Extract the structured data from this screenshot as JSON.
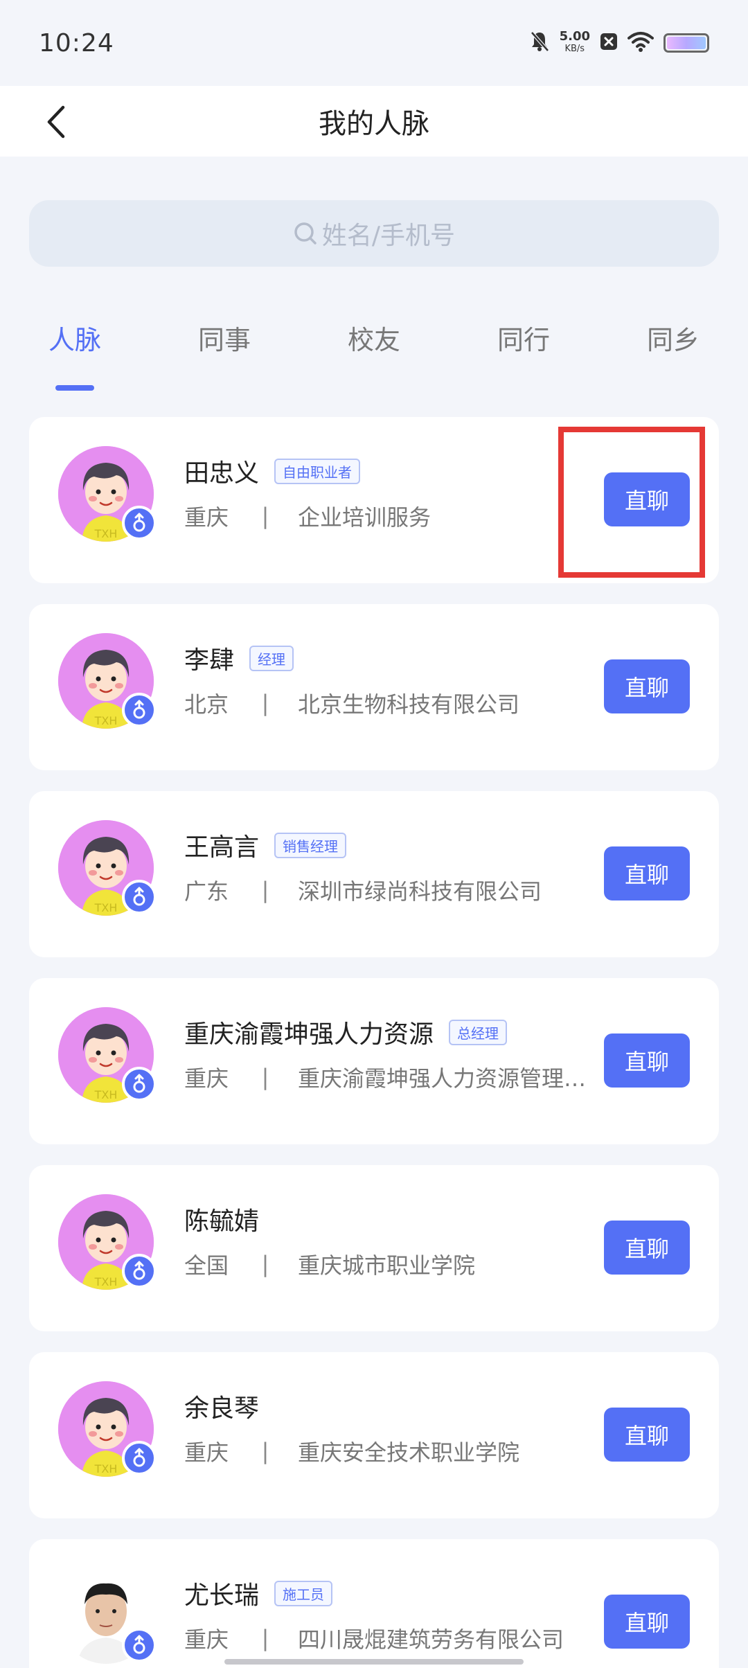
{
  "status_bar": {
    "time": "10:24",
    "speed_value": "5.00",
    "speed_unit": "KB/s",
    "icons": [
      "mute-bell-icon",
      "close-box-icon",
      "wifi-icon",
      "battery-icon"
    ]
  },
  "header": {
    "title": "我的人脉",
    "back_icon": "chevron-left-icon"
  },
  "search": {
    "placeholder": "姓名/手机号",
    "icon": "search-icon"
  },
  "tabs": [
    {
      "label": "人脉",
      "active": true
    },
    {
      "label": "同事",
      "active": false
    },
    {
      "label": "校友",
      "active": false
    },
    {
      "label": "同行",
      "active": false
    },
    {
      "label": "同乡",
      "active": false
    }
  ],
  "contacts": [
    {
      "name": "田忠义",
      "tag": "自由职业者",
      "city": "重庆",
      "company": "企业培训服务",
      "button": "直聊",
      "gender_icon": "male-icon"
    },
    {
      "name": "李肆",
      "tag": "经理",
      "city": "北京",
      "company": "北京生物科技有限公司",
      "button": "直聊",
      "gender_icon": "male-icon"
    },
    {
      "name": "王高言",
      "tag": "销售经理",
      "city": "广东",
      "company": "深圳市绿尚科技有限公司",
      "button": "直聊",
      "gender_icon": "male-icon"
    },
    {
      "name": "重庆渝霞坤强人力资源",
      "tag": "总经理",
      "city": "重庆",
      "company": "重庆渝霞坤强人力资源管理…",
      "button": "直聊",
      "gender_icon": "male-icon"
    },
    {
      "name": "陈毓婧",
      "tag": "",
      "city": "全国",
      "company": "重庆城市职业学院",
      "button": "直聊",
      "gender_icon": "male-icon"
    },
    {
      "name": "余良琴",
      "tag": "",
      "city": "重庆",
      "company": "重庆安全技术职业学院",
      "button": "直聊",
      "gender_icon": "male-icon"
    },
    {
      "name": "尤长瑞",
      "tag": "施工员",
      "city": "重庆",
      "company": "四川晟焜建筑劳务有限公司",
      "button": "直聊",
      "gender_icon": "male-icon"
    }
  ],
  "colors": {
    "accent": "#5470f5",
    "background": "#f3f5fa",
    "highlight": "#e53935",
    "avatar_bg": "#e58ef0"
  }
}
